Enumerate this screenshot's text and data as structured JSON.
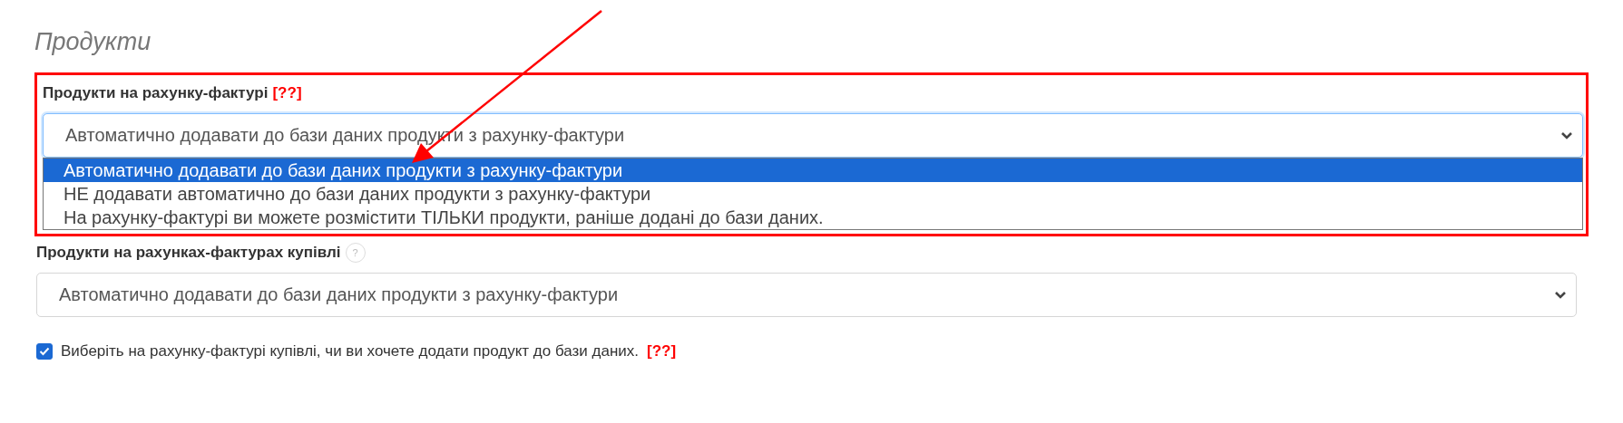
{
  "heading": "Продукти",
  "invoice_products": {
    "label": "Продукти на рахунку-фактурі",
    "hint": "[??]",
    "value": "Автоматично додавати до бази даних продукти з рахунку-фактури",
    "expanded": true,
    "options": [
      {
        "label": "Автоматично додавати до бази даних продукти з рахунку-фактури",
        "selected": true
      },
      {
        "label": "НЕ додавати автоматично до бази даних продукти з рахунку-фактури",
        "selected": false
      },
      {
        "label": "На рахунку-фактурі ви можете розмістити ТІЛЬКИ продукти, раніше додані до бази даних.",
        "selected": false
      }
    ]
  },
  "purchase_products": {
    "label": "Продукти на рахунках-фактурах купівлі",
    "help": "?",
    "value": "Автоматично додавати до бази даних продукти з рахунку-фактури"
  },
  "ask_checkbox": {
    "label": "Виберіть на рахунку-фактурі купівлі, чи ви хочете додати продукт до бази даних.",
    "hint": "[??]",
    "checked": true
  }
}
